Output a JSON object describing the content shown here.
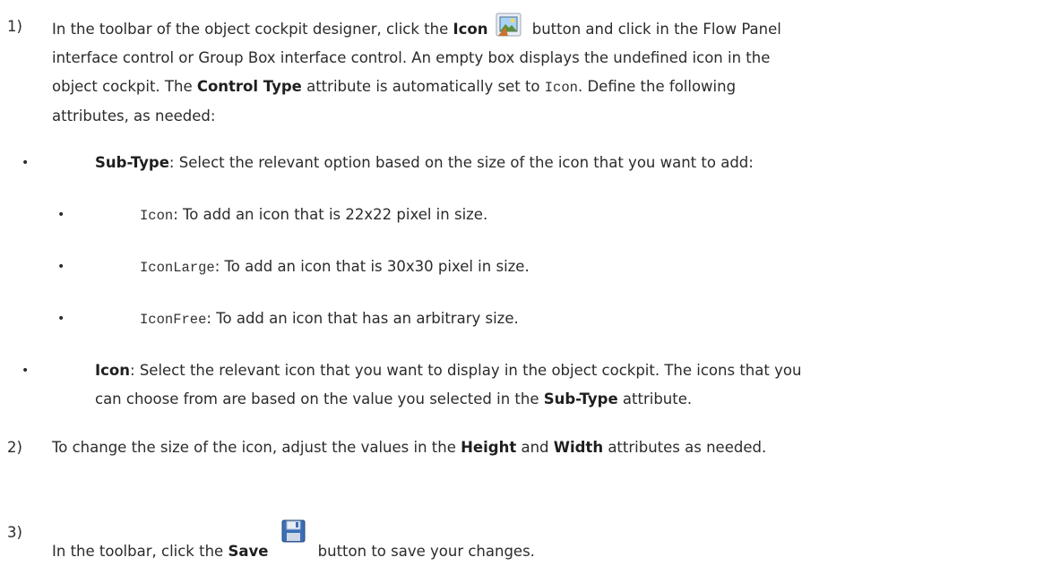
{
  "steps": [
    {
      "num": "1)",
      "l1_a": "In the toolbar of the object cockpit designer, click the ",
      "l1_bold": "Icon",
      "l1_b": " button and click in the Flow Panel",
      "l2": "interface control or Group Box interface control. An empty box displays the undefined icon in the",
      "l3_a": "object cockpit. The ",
      "l3_bold": "Control Type",
      "l3_b": " attribute is automatically set to ",
      "l3_code": "Icon",
      "l3_c": ". Define the following",
      "l4": "attributes, as needed:"
    },
    {
      "num": "2)",
      "a": "To change the size of the icon, adjust the values in the ",
      "bold1": "Height",
      "b": " and ",
      "bold2": "Width",
      "c": " attributes as needed."
    },
    {
      "num": "3)",
      "a": "In the toolbar, click the ",
      "bold": "Save",
      "b": " button to save your changes."
    }
  ],
  "attributes": [
    {
      "bullet": "•",
      "name": "Sub-Type",
      "desc": ": Select the relevant option based on the size of the icon that you want to add:",
      "options": [
        {
          "bullet": "•",
          "code": "Icon",
          "desc": ": To add an icon that is 22x22 pixel in size."
        },
        {
          "bullet": "•",
          "code": "IconLarge",
          "desc": ": To add an icon that is 30x30 pixel in size."
        },
        {
          "bullet": "•",
          "code": "IconFree",
          "desc": ": To add an icon that has an arbitrary size."
        }
      ]
    },
    {
      "bullet": "•",
      "name": "Icon",
      "desc1": ": Select the relevant icon that you want to display in the object cockpit. The icons that you",
      "desc2_a": "can choose from are based on the value you selected in the ",
      "desc2_bold": "Sub-Type",
      "desc2_b": " attribute."
    }
  ],
  "icons": [
    "image-icon",
    "save-icon"
  ]
}
